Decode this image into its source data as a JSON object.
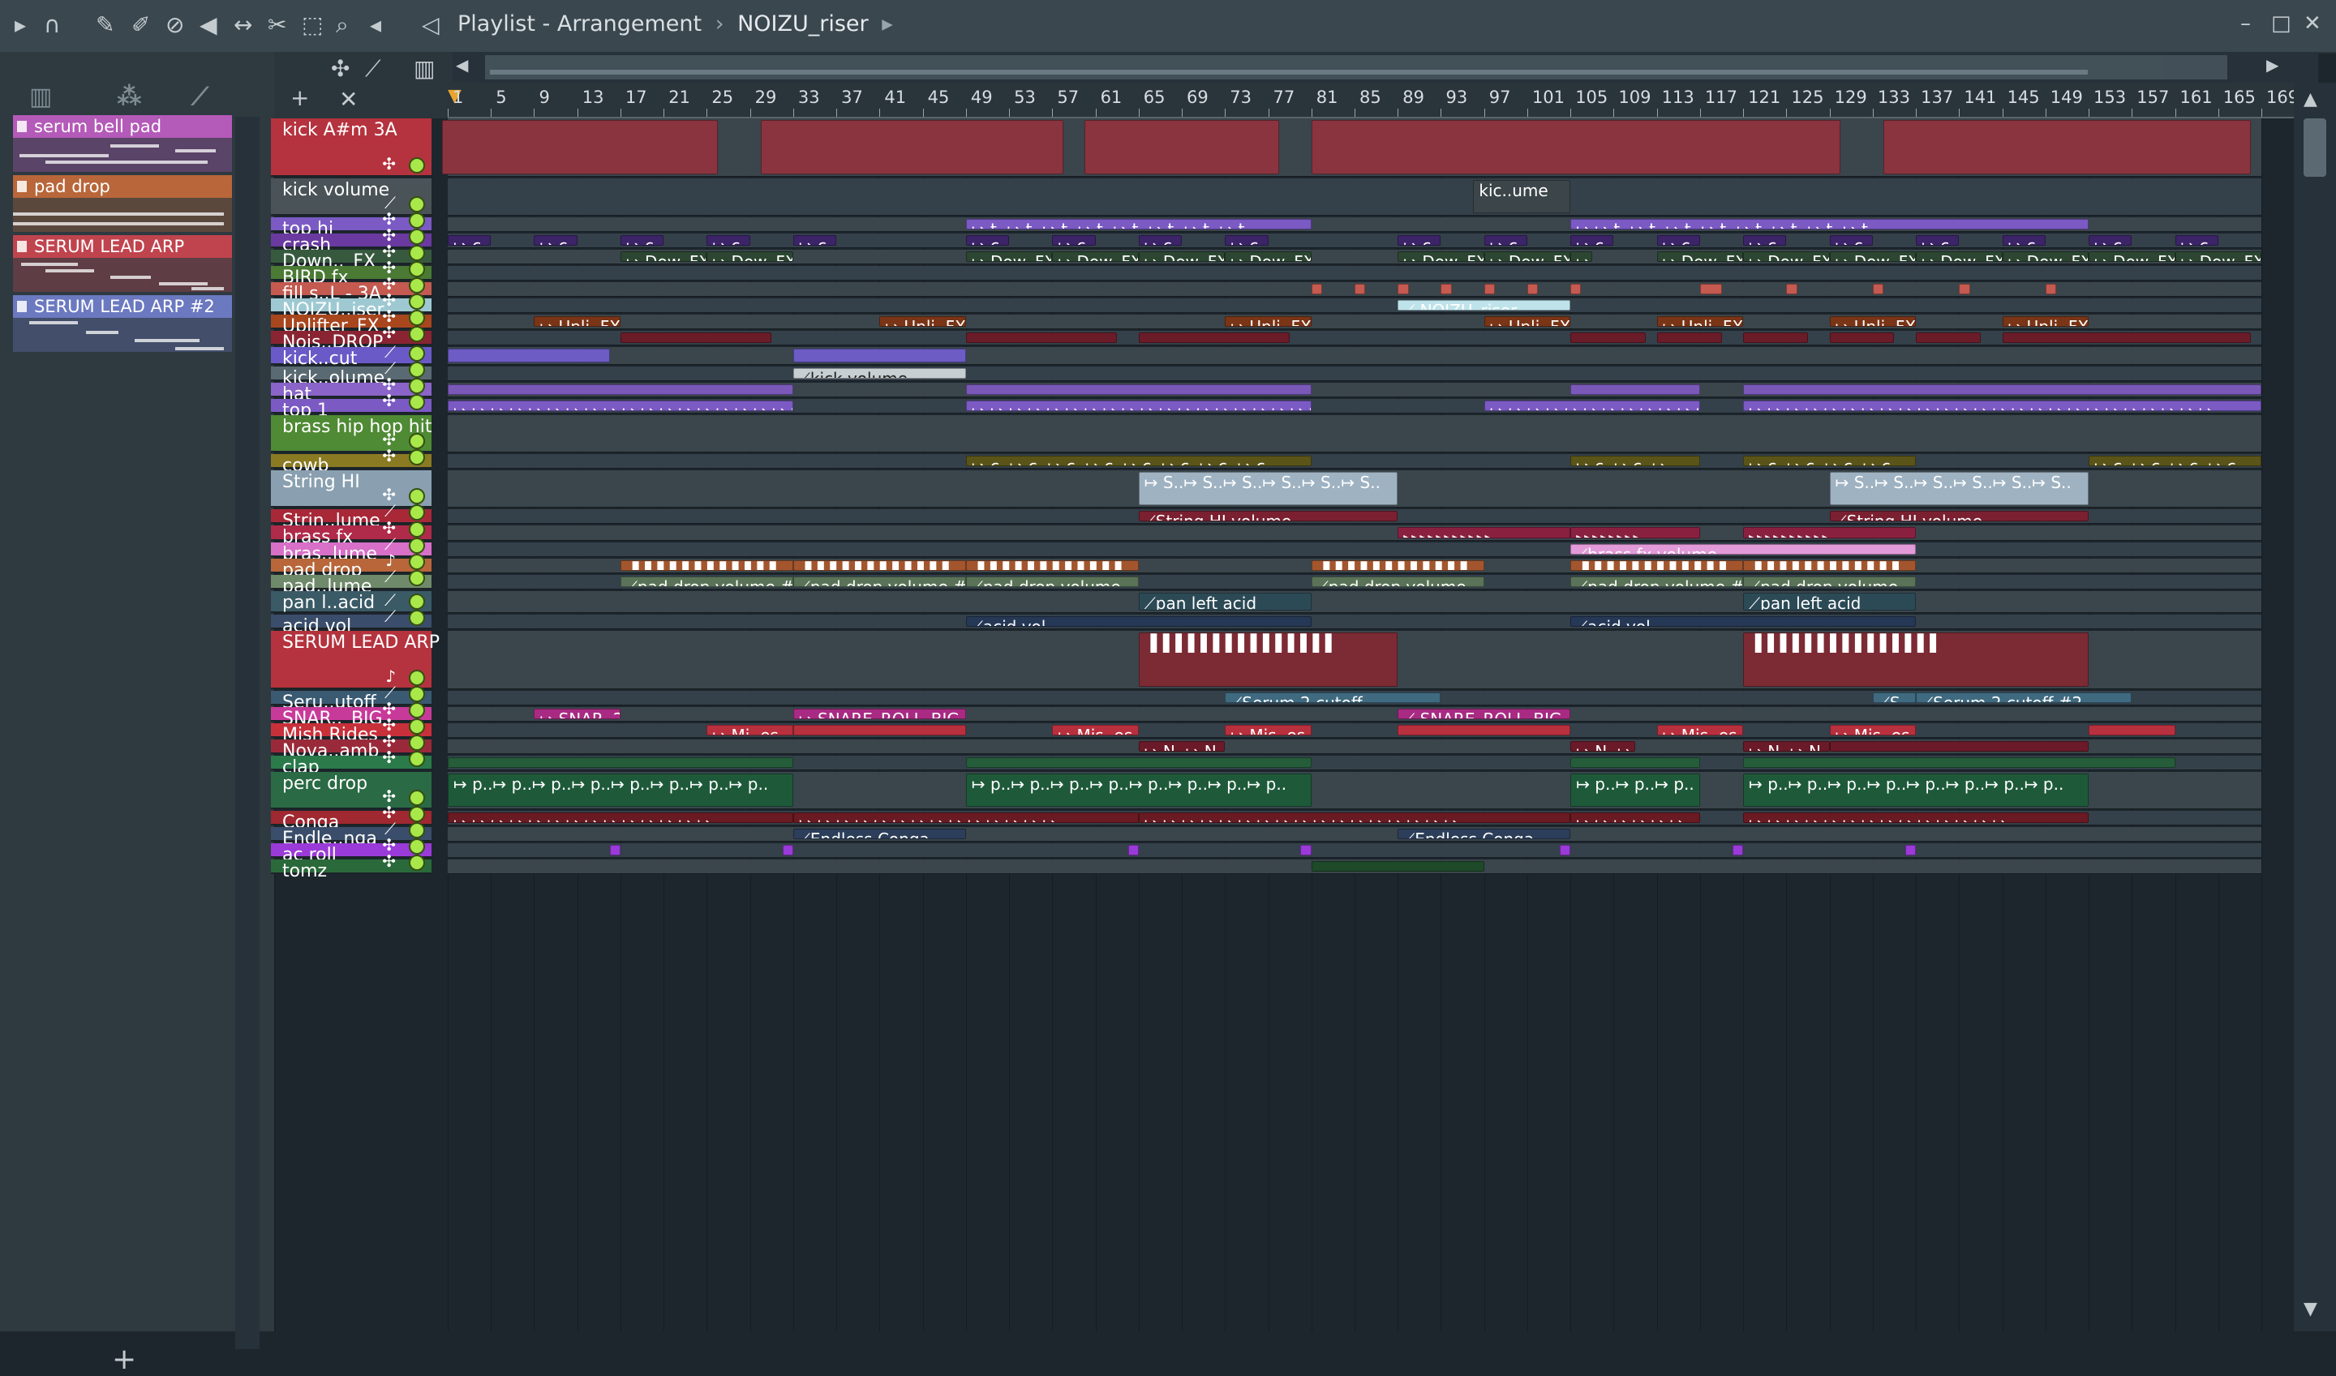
{
  "window": {
    "title_prefix": "Playlist - Arrangement",
    "breadcrumb": "NOIZU_riser",
    "separator": "›"
  },
  "toolbar": {
    "icons": [
      "play-arrow-icon",
      "magnet-icon",
      "pencil-icon",
      "paint-icon",
      "delete-icon",
      "mute-icon",
      "slip-icon",
      "slice-icon",
      "select-icon",
      "zoom-icon",
      "playback-icon",
      "speaker-icon"
    ]
  },
  "picker": {
    "items": [
      {
        "label": "serum bell pad",
        "color": "#b45ab8"
      },
      {
        "label": "pad drop",
        "color": "#b8663a"
      },
      {
        "label": "SERUM LEAD ARP",
        "color": "#c0444e"
      },
      {
        "label": "SERUM LEAD ARP  #2",
        "color": "#6b79c0"
      }
    ],
    "add_label": "+"
  },
  "ruler": {
    "labels": [
      "1",
      "5",
      "9",
      "13",
      "17",
      "21",
      "25",
      "29",
      "33",
      "37",
      "41",
      "45",
      "49",
      "53",
      "57",
      "61",
      "65",
      "69",
      "73",
      "77",
      "81",
      "85",
      "89",
      "93",
      "97",
      "101",
      "105",
      "109",
      "113",
      "117",
      "121",
      "125",
      "129",
      "133",
      "137",
      "141",
      "145",
      "149",
      "153",
      "157",
      "161",
      "165",
      "169"
    ]
  },
  "tracks": [
    {
      "name": "kick A#m 3A",
      "color": "#b5333e",
      "height": 2,
      "icon": "✣",
      "clips": [
        {
          "s": 0.5,
          "e": 26
        },
        {
          "s": 30,
          "e": 58
        },
        {
          "s": 60,
          "e": 78
        },
        {
          "s": 81,
          "e": 130
        },
        {
          "s": 134,
          "e": 168
        }
      ],
      "clip_color": "#8a3440",
      "clip_label": ""
    },
    {
      "name": "kick volume",
      "color": "#4a5357",
      "height": 1.2,
      "icon": "⟋",
      "clips": [
        {
          "s": 96,
          "e": 105,
          "l": "kic..ume"
        }
      ],
      "clip_color": "#3c4549",
      "clip_label": ""
    },
    {
      "name": "top hi",
      "color": "#7b5ac4",
      "height": 0.55,
      "icon": "✣",
      "clips": [
        {
          "s": 49,
          "e": 81,
          "l": "↦ t..↦ t..↦ t..↦ t..↦ t..↦ t..↦ t..↦ t.."
        },
        {
          "s": 105,
          "e": 153,
          "l": "↦ ↦ t..↦ t..↦ t..↦ t..↦ t..↦ t..↦ t..↦ t.."
        }
      ],
      "clip_color": "#7b5ac4"
    },
    {
      "name": "crash",
      "color": "#6a3aa0",
      "height": 0.55,
      "icon": "✣",
      "clips": [
        {
          "s": 1,
          "e": 5,
          "l": "↦ c.."
        },
        {
          "s": 9,
          "e": 13,
          "l": "↦ c.."
        },
        {
          "s": 17,
          "e": 21,
          "l": "↦ c.."
        },
        {
          "s": 25,
          "e": 29,
          "l": "↦ c.."
        },
        {
          "s": 33,
          "e": 37,
          "l": "↦ c.."
        },
        {
          "s": 49,
          "e": 53,
          "l": "↦ c.."
        },
        {
          "s": 57,
          "e": 61,
          "l": "↦ c.."
        },
        {
          "s": 65,
          "e": 69,
          "l": "↦ c.."
        },
        {
          "s": 73,
          "e": 77,
          "l": "↦ c.."
        },
        {
          "s": 89,
          "e": 93,
          "l": "↦ c.."
        },
        {
          "s": 97,
          "e": 101,
          "l": "↦ c.."
        },
        {
          "s": 105,
          "e": 109,
          "l": "↦ c.."
        },
        {
          "s": 113,
          "e": 117,
          "l": "↦ c.."
        },
        {
          "s": 121,
          "e": 125,
          "l": "↦ c.."
        },
        {
          "s": 129,
          "e": 133,
          "l": "↦ c.."
        },
        {
          "s": 137,
          "e": 141,
          "l": "↦ c.."
        },
        {
          "s": 145,
          "e": 149,
          "l": "↦ c.."
        },
        {
          "s": 153,
          "e": 157,
          "l": "↦ c.."
        },
        {
          "s": 161,
          "e": 165,
          "l": "↦ c.."
        }
      ],
      "clip_color": "#3c2468"
    },
    {
      "name": "Down.._FX",
      "color": "#375a3e",
      "height": 0.55,
      "icon": "✣",
      "clips": [
        {
          "s": 17,
          "e": 25,
          "l": "↦ Dow..FX"
        },
        {
          "s": 25,
          "e": 33,
          "l": "↦ Dow..FX"
        },
        {
          "s": 49,
          "e": 57,
          "l": "↦ Dow..FX"
        },
        {
          "s": 57,
          "e": 65,
          "l": "↦ Dow..FX"
        },
        {
          "s": 65,
          "e": 73,
          "l": "↦ Dow..FX"
        },
        {
          "s": 73,
          "e": 81,
          "l": "↦ Dow..FX"
        },
        {
          "s": 89,
          "e": 97,
          "l": "↦ Dow..FX"
        },
        {
          "s": 97,
          "e": 105,
          "l": "↦ Dow..FX"
        },
        {
          "s": 105,
          "e": 107,
          "l": "↦"
        },
        {
          "s": 113,
          "e": 121,
          "l": "↦ Dow..FX"
        },
        {
          "s": 121,
          "e": 129,
          "l": "↦ Dow..FX"
        },
        {
          "s": 129,
          "e": 137,
          "l": "↦ Dow..FX"
        },
        {
          "s": 137,
          "e": 145,
          "l": "↦ Dow..FX"
        },
        {
          "s": 145,
          "e": 153,
          "l": "↦ Dow..FX"
        },
        {
          "s": 153,
          "e": 161,
          "l": "↦ Dow..FX"
        },
        {
          "s": 161,
          "e": 169,
          "l": "↦ Dow..FX"
        }
      ],
      "clip_color": "#2c4632"
    },
    {
      "name": "BIRD fx",
      "color": "#4a7a34",
      "height": 0.55,
      "icon": "✣",
      "clips": [],
      "clip_color": "#4a7a34"
    },
    {
      "name": "fill s..L - 3A",
      "color": "#c45a50",
      "height": 0.55,
      "icon": "✣",
      "clips": [
        {
          "s": 81,
          "e": 82
        },
        {
          "s": 85,
          "e": 86
        },
        {
          "s": 89,
          "e": 90
        },
        {
          "s": 93,
          "e": 94
        },
        {
          "s": 97,
          "e": 98
        },
        {
          "s": 101,
          "e": 102
        },
        {
          "s": 105,
          "e": 106
        },
        {
          "s": 117,
          "e": 119
        },
        {
          "s": 125,
          "e": 126
        },
        {
          "s": 133,
          "e": 134
        },
        {
          "s": 141,
          "e": 142
        },
        {
          "s": 149,
          "e": 150
        }
      ],
      "clip_color": "#c45a50"
    },
    {
      "name": "NOIZU..iser",
      "color": "#9ec9d2",
      "height": 0.55,
      "icon": "✣",
      "clips": [
        {
          "s": 89,
          "e": 105,
          "l": "⟋ NOIZU_riser"
        }
      ],
      "clip_color": "#bfe3ea"
    },
    {
      "name": "Uplifter_FX",
      "color": "#a8461e",
      "height": 0.55,
      "icon": "✣",
      "clips": [
        {
          "s": 9,
          "e": 17,
          "l": "↦ Upli..FX"
        },
        {
          "s": 41,
          "e": 49,
          "l": "↦ Upli..FX"
        },
        {
          "s": 73,
          "e": 81,
          "l": "↦ Upli..FX"
        },
        {
          "s": 97,
          "e": 105,
          "l": "↦ Upli..FX"
        },
        {
          "s": 113,
          "e": 121,
          "l": "↦ Upli..FX"
        },
        {
          "s": 129,
          "e": 137,
          "l": "↦ Upli..FX"
        },
        {
          "s": 145,
          "e": 153,
          "l": "↦ Upli..FX"
        }
      ],
      "clip_color": "#7a3416"
    },
    {
      "name": "Nois..DROP",
      "color": "#8a2432",
      "height": 0.55,
      "icon": "✣",
      "clips": [
        {
          "s": 17,
          "e": 31
        },
        {
          "s": 49,
          "e": 63
        },
        {
          "s": 65,
          "e": 79
        },
        {
          "s": 105,
          "e": 112
        },
        {
          "s": 113,
          "e": 119
        },
        {
          "s": 121,
          "e": 127
        },
        {
          "s": 129,
          "e": 135
        },
        {
          "s": 137,
          "e": 143
        },
        {
          "s": 145,
          "e": 168
        }
      ],
      "clip_color": "#6a1c28"
    },
    {
      "name": "kick..cut",
      "color": "#6a5ac8",
      "height": 0.7,
      "icon": "⟋",
      "clips": [
        {
          "s": 1,
          "e": 16
        },
        {
          "s": 33,
          "e": 49
        }
      ],
      "clip_color": "#6c5cc4"
    },
    {
      "name": "kick..olume",
      "color": "#5a6a72",
      "height": 0.55,
      "icon": "⟋",
      "clips": [
        {
          "s": 33,
          "e": 49,
          "l": "⟋kick volume"
        }
      ],
      "clip_color": "#c8cfd2",
      "dark_text": true
    },
    {
      "name": "hat",
      "color": "#8a64c8",
      "height": 0.55,
      "icon": "✣",
      "clips": [
        {
          "s": 1,
          "e": 33
        },
        {
          "s": 49,
          "e": 81
        },
        {
          "s": 105,
          "e": 117
        },
        {
          "s": 121,
          "e": 169
        }
      ],
      "clip_color": "#7a58b8"
    },
    {
      "name": "top 1",
      "color": "#7b5ac4",
      "height": 0.55,
      "icon": "✣",
      "clips": [
        {
          "s": 1,
          "e": 33,
          "l": "↦ ↦ ↦ ↦ ↦ ↦ ↦ ↦ ↦ ↦ ↦ ↦ ↦ ↦ ↦ ↦ ↦ ↦ ↦ ↦"
        },
        {
          "s": 49,
          "e": 81,
          "l": "↦ ↦ ↦ ↦ ↦ ↦ ↦ ↦ ↦ ↦ ↦ ↦ ↦ ↦ ↦ ↦ ↦ ↦ ↦ ↦"
        },
        {
          "s": 97,
          "e": 117,
          "l": "↦ ↦ ↦ ↦ ↦ ↦ ↦ ↦ ↦ ↦ ↦ ↦"
        },
        {
          "s": 121,
          "e": 169,
          "l": "↦ ↦ ↦ ↦ ↦ ↦ ↦ ↦ ↦ ↦ ↦ ↦ ↦ ↦ ↦ ↦ ↦ ↦ ↦ ↦ ↦ ↦ ↦ ↦ ↦"
        }
      ],
      "clip_color": "#7b5ac4"
    },
    {
      "name": "brass hip hop hit",
      "color": "#4f8a34",
      "height": 1.2,
      "icon": "✣",
      "clips": [],
      "clip_color": "#3a5a2a"
    },
    {
      "name": "cowb",
      "color": "#8a7a22",
      "height": 0.55,
      "icon": "✣",
      "clips": [
        {
          "s": 49,
          "e": 81,
          "l": "↦ c..↦ c..↦ c..↦ c..↦ c..↦ c..↦ c..↦ c.."
        },
        {
          "s": 105,
          "e": 117,
          "l": "↦ c..↦ c..↦"
        },
        {
          "s": 121,
          "e": 137,
          "l": "↦ c..↦ c..↦ c..↦ c.."
        },
        {
          "s": 153,
          "e": 169,
          "l": "↦ c..↦ c..↦ c..↦ c.."
        }
      ],
      "clip_color": "#5a5418"
    },
    {
      "name": "String HI",
      "color": "#8aa0b0",
      "height": 1.2,
      "icon": "✣",
      "clips": [
        {
          "s": 65,
          "e": 89,
          "l": "↦ S..↦ S..↦ S..↦ S..↦ S..↦ S.."
        },
        {
          "s": 129,
          "e": 153,
          "l": "↦ S..↦ S..↦ S..↦ S..↦ S..↦ S.."
        }
      ],
      "clip_color": "#9eb2c2"
    },
    {
      "name": "Strin..lume",
      "color": "#a82838",
      "height": 0.55,
      "icon": "⟋",
      "clips": [
        {
          "s": 65,
          "e": 89,
          "l": "⟋String HI volume"
        },
        {
          "s": 129,
          "e": 153,
          "l": "⟋String HI volume"
        }
      ],
      "clip_color": "#7a2030"
    },
    {
      "name": "brass fx",
      "color": "#b02a4a",
      "height": 0.6,
      "icon": "✣",
      "clips": [
        {
          "s": 89,
          "e": 105,
          "l": "▸▸▸▸▸▸▸▸▸▸▸"
        },
        {
          "s": 105,
          "e": 117,
          "l": "▸▸▸▸▸▸▸▸"
        },
        {
          "s": 121,
          "e": 137,
          "l": "▸▸▸▸▸▸▸▸▸▸"
        }
      ],
      "clip_color": "#8a2040"
    },
    {
      "name": "bras..lume",
      "color": "#d870c8",
      "height": 0.55,
      "icon": "⟋",
      "clips": [
        {
          "s": 105,
          "e": 137,
          "l": "⟋brass fx volume"
        }
      ],
      "clip_color": "#e29ad8"
    },
    {
      "name": "pad drop",
      "color": "#b8663a",
      "height": 0.55,
      "icon": "♪",
      "clips": [
        {
          "s": 17,
          "e": 33,
          "l": "▐▐▐▐▐▐▐▐▐▐▐▐"
        },
        {
          "s": 33,
          "e": 49,
          "l": "▐▐▐▐▐▐▐▐▐▐▐▐"
        },
        {
          "s": 49,
          "e": 65,
          "l": "▐▐▐▐▐▐▐▐▐▐▐▐"
        },
        {
          "s": 81,
          "e": 97,
          "l": "▐▐▐▐▐▐▐▐▐▐▐▐"
        },
        {
          "s": 105,
          "e": 121,
          "l": "▐▐▐▐▐▐▐▐▐▐▐▐"
        },
        {
          "s": 121,
          "e": 137,
          "l": "▐▐▐▐▐▐▐▐▐▐▐▐"
        }
      ],
      "clip_color": "#a3562e"
    },
    {
      "name": "pad..lume",
      "color": "#6f8a6a",
      "height": 0.55,
      "icon": "⟋",
      "clips": [
        {
          "s": 17,
          "e": 33,
          "l": "⟋pad drop volume #3"
        },
        {
          "s": 33,
          "e": 49,
          "l": "⟋pad drop volume #2"
        },
        {
          "s": 49,
          "e": 65,
          "l": "⟋pad drop volume"
        },
        {
          "s": 81,
          "e": 97,
          "l": "⟋pad drop volume"
        },
        {
          "s": 105,
          "e": 121,
          "l": "⟋pad drop volume #4"
        },
        {
          "s": 121,
          "e": 137,
          "l": "⟋pad drop volume"
        }
      ],
      "clip_color": "#5a7358"
    },
    {
      "name": "pan l..acid",
      "color": "#3a5a66",
      "height": 0.85,
      "icon": "⟋",
      "clips": [
        {
          "s": 65,
          "e": 81,
          "l": "⟋pan left acid"
        },
        {
          "s": 121,
          "e": 137,
          "l": "⟋pan left acid"
        }
      ],
      "clip_color": "#2c4a56"
    },
    {
      "name": "acid vol",
      "color": "#3a4d6a",
      "height": 0.55,
      "icon": "⟋",
      "clips": [
        {
          "s": 49,
          "e": 81,
          "l": "⟋acid vol"
        },
        {
          "s": 105,
          "e": 137,
          "l": "⟋acid vol"
        }
      ],
      "clip_color": "#253856"
    },
    {
      "name": "SERUM LEAD ARP",
      "color": "#b5333e",
      "height": 2,
      "icon": "♪",
      "clips": [
        {
          "s": 65,
          "e": 89,
          "l": "▐▐▐▐▐▐▐▐▐▐▐▐▐▐▐"
        },
        {
          "s": 121,
          "e": 153,
          "l": "▐▐▐▐▐▐▐▐▐▐▐▐▐▐▐"
        }
      ],
      "clip_color": "#7c2a34"
    },
    {
      "name": "Seru..utoff",
      "color": "#3a5a72",
      "height": 0.55,
      "icon": "⟋",
      "clips": [
        {
          "s": 73,
          "e": 93,
          "l": "⟋Serum 2 cutoff"
        },
        {
          "s": 133,
          "e": 137,
          "l": "⟋S.."
        },
        {
          "s": 137,
          "e": 157,
          "l": "⟋Serum 2 cutoff  #2"
        }
      ],
      "clip_color": "#3f6a80"
    },
    {
      "name": "SNAR.._BIG",
      "color": "#c83a9a",
      "height": 0.55,
      "icon": "✣",
      "clips": [
        {
          "s": 9,
          "e": 17,
          "l": "↦ SNAR..2"
        },
        {
          "s": 33,
          "e": 49,
          "l": "↦ SNARE_ROLL_BIG #2"
        },
        {
          "s": 89,
          "e": 105,
          "l": "⟋ SNARE_ROLL_BIG"
        }
      ],
      "clip_color": "#a82a82"
    },
    {
      "name": "Mish Rides",
      "color": "#c8303a",
      "height": 0.55,
      "icon": "✣",
      "clips": [
        {
          "s": 25,
          "e": 33,
          "l": "↦ Mi..es"
        },
        {
          "s": 33,
          "e": 49
        },
        {
          "s": 57,
          "e": 65,
          "l": "↦ Mis..es"
        },
        {
          "s": 73,
          "e": 81,
          "l": "↦ Mis..es"
        },
        {
          "s": 89,
          "e": 105
        },
        {
          "s": 113,
          "e": 121,
          "l": "↦ Mis..es"
        },
        {
          "s": 129,
          "e": 137,
          "l": "↦ Mis..es"
        },
        {
          "s": 153,
          "e": 161
        }
      ],
      "clip_color": "#b8303e"
    },
    {
      "name": "Nova..amb",
      "color": "#9a2a3a",
      "height": 0.55,
      "icon": "✣",
      "clips": [
        {
          "s": 65,
          "e": 73,
          "l": "↦ N..↦ N.."
        },
        {
          "s": 105,
          "e": 111,
          "l": "↦ N..↦"
        },
        {
          "s": 121,
          "e": 129,
          "l": "↦ N..↦ N.."
        },
        {
          "s": 129,
          "e": 153
        }
      ],
      "clip_color": "#6a1a28"
    },
    {
      "name": "clap",
      "color": "#2a7a4a",
      "height": 0.55,
      "icon": "✣",
      "clips": [
        {
          "s": 1,
          "e": 33
        },
        {
          "s": 49,
          "e": 81
        },
        {
          "s": 105,
          "e": 117
        },
        {
          "s": 121,
          "e": 161
        }
      ],
      "clip_color": "#255c3a"
    },
    {
      "name": "perc drop",
      "color": "#2a6a44",
      "height": 1.2,
      "icon": "✣",
      "clips": [
        {
          "s": 1,
          "e": 33,
          "l": "↦ p..↦ p..↦ p..↦ p..↦ p..↦ p..↦ p..↦ p.."
        },
        {
          "s": 49,
          "e": 81,
          "l": "↦ p..↦ p..↦ p..↦ p..↦ p..↦ p..↦ p..↦ p.."
        },
        {
          "s": 105,
          "e": 117,
          "l": "↦ p..↦ p..↦ p.."
        },
        {
          "s": 121,
          "e": 153,
          "l": "↦ p..↦ p..↦ p..↦ p..↦ p..↦ p..↦ p..↦ p.."
        }
      ],
      "clip_color": "#1e5a3a"
    },
    {
      "name": "Conga",
      "color": "#a02830",
      "height": 0.55,
      "icon": "✣",
      "clips": [
        {
          "s": 1,
          "e": 33,
          "l": "↦ ↦ ↦ ↦ ↦ ↦ ↦ ↦ ↦ ↦ ↦ ↦ ↦ ↦"
        },
        {
          "s": 33,
          "e": 65,
          "l": "↦ ↦ ↦ ↦ ↦ ↦ ↦ ↦ ↦ ↦ ↦ ↦ ↦ ↦"
        },
        {
          "s": 65,
          "e": 105,
          "l": "↦ ↦ ↦ ↦ ↦ ↦ ↦ ↦ ↦ ↦ ↦ ↦ ↦ ↦ ↦ ↦ ↦"
        },
        {
          "s": 105,
          "e": 117,
          "l": "↦ ↦ ↦ ↦ ↦ ↦"
        },
        {
          "s": 121,
          "e": 153,
          "l": "↦ ↦ ↦ ↦ ↦ ↦ ↦ ↦ ↦ ↦ ↦ ↦ ↦ ↦"
        }
      ],
      "clip_color": "#6a1a22"
    },
    {
      "name": "Endle..nga",
      "color": "#3a4d6a",
      "height": 0.55,
      "icon": "⟋",
      "clips": [
        {
          "s": 33,
          "e": 49,
          "l": "⟋Endless Conga"
        },
        {
          "s": 89,
          "e": 105,
          "l": "⟋Endless Conga"
        }
      ],
      "clip_color": "#2c3e5a"
    },
    {
      "name": "ac roll",
      "color": "#9a3ad8",
      "height": 0.55,
      "icon": "✣",
      "clips": [
        {
          "s": 16,
          "e": 17
        },
        {
          "s": 32,
          "e": 33
        },
        {
          "s": 64,
          "e": 65
        },
        {
          "s": 80,
          "e": 81
        },
        {
          "s": 104,
          "e": 105
        },
        {
          "s": 120,
          "e": 121
        },
        {
          "s": 136,
          "e": 137
        }
      ],
      "clip_color": "#9a3ad8"
    },
    {
      "name": "tomz",
      "color": "#2a6a3a",
      "height": 0.55,
      "icon": "✣",
      "clips": [
        {
          "s": 81,
          "e": 97
        }
      ],
      "clip_color": "#1e4a2a"
    }
  ]
}
